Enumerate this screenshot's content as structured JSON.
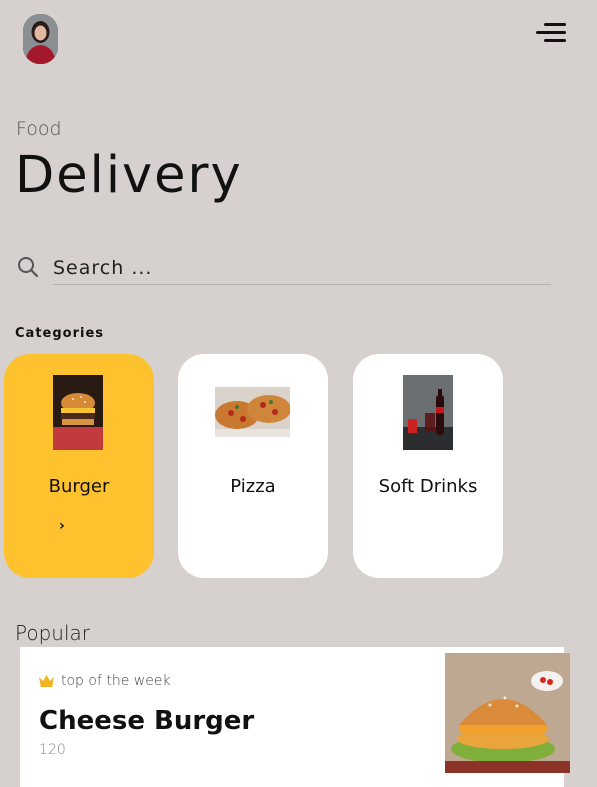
{
  "header": {
    "avatar_alt": "user-avatar",
    "menu_icon": "hamburger-menu-icon"
  },
  "hero": {
    "kicker": "Food",
    "title": "Delivery"
  },
  "search": {
    "placeholder": "Search ...",
    "value": "",
    "icon": "search-icon"
  },
  "categories": {
    "heading": "Categories",
    "items": [
      {
        "label": "Burger",
        "active": true,
        "image": "burger-photo"
      },
      {
        "label": "Pizza",
        "active": false,
        "image": "pizza-photo"
      },
      {
        "label": "Soft Drinks",
        "active": false,
        "image": "soft-drinks-photo"
      }
    ],
    "active_color": "#fdc22e"
  },
  "popular": {
    "heading": "Popular",
    "items": [
      {
        "tag": "top of the week",
        "name": "Cheese Burger",
        "price": "120",
        "image": "cheese-burger-photo"
      }
    ]
  },
  "colors": {
    "background": "#d6d0ce",
    "accent": "#fdc22e",
    "card": "#ffffff"
  }
}
